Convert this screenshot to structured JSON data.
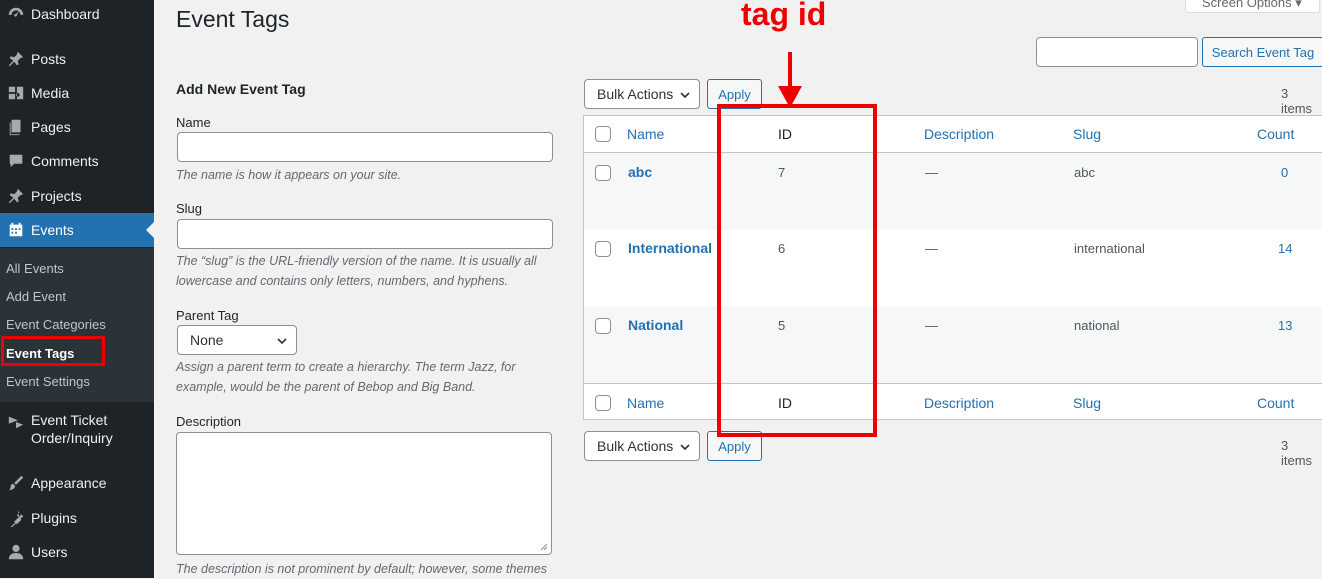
{
  "sidebar": {
    "items": [
      {
        "label": "Dashboard",
        "icon": "dashboard-icon"
      },
      {
        "label": "Posts",
        "icon": "pin-icon"
      },
      {
        "label": "Media",
        "icon": "media-icon"
      },
      {
        "label": "Pages",
        "icon": "pages-icon"
      },
      {
        "label": "Comments",
        "icon": "comments-icon"
      },
      {
        "label": "Projects",
        "icon": "pin-icon"
      },
      {
        "label": "Events",
        "icon": "calendar-icon"
      },
      {
        "label": "Event Ticket Order/Inquiry",
        "icon": "ticket-icon"
      },
      {
        "label": "Appearance",
        "icon": "brush-icon"
      },
      {
        "label": "Plugins",
        "icon": "plugin-icon"
      },
      {
        "label": "Users",
        "icon": "users-icon"
      }
    ],
    "event_ticket_line1": "Event Ticket",
    "event_ticket_line2": "Order/Inquiry",
    "submenu": [
      "All Events",
      "Add Event",
      "Event Categories",
      "Event Tags",
      "Event Settings"
    ],
    "active_color": "#2271b1"
  },
  "header": {
    "title": "Event Tags",
    "screen_options": "Screen Options",
    "search_button": "Search Event Tag",
    "search_value": ""
  },
  "form": {
    "heading": "Add New Event Tag",
    "name_label": "Name",
    "name_help": "The name is how it appears on your site.",
    "slug_label": "Slug",
    "slug_help": "The “slug” is the URL-friendly version of the name. It is usually all lowercase and contains only letters, numbers, and hyphens.",
    "parent_label": "Parent Tag",
    "parent_value": "None",
    "parent_help": "Assign a parent term to create a hierarchy. The term Jazz, for example, would be the parent of Bebop and Big Band.",
    "description_label": "Description",
    "description_help": "The description is not prominent by default; however, some themes"
  },
  "table": {
    "bulk_label": "Bulk Actions",
    "apply_label": "Apply",
    "items_count": "3 items",
    "columns": {
      "name": "Name",
      "id": "ID",
      "description": "Description",
      "slug": "Slug",
      "count": "Count"
    },
    "rows": [
      {
        "name": "abc",
        "id": "7",
        "description": "—",
        "slug": "abc",
        "count": "0"
      },
      {
        "name": "International",
        "id": "6",
        "description": "—",
        "slug": "international",
        "count": "14"
      },
      {
        "name": "National",
        "id": "5",
        "description": "—",
        "slug": "national",
        "count": "13"
      }
    ]
  },
  "annotation": {
    "label": "tag id",
    "color": "#e00000"
  }
}
